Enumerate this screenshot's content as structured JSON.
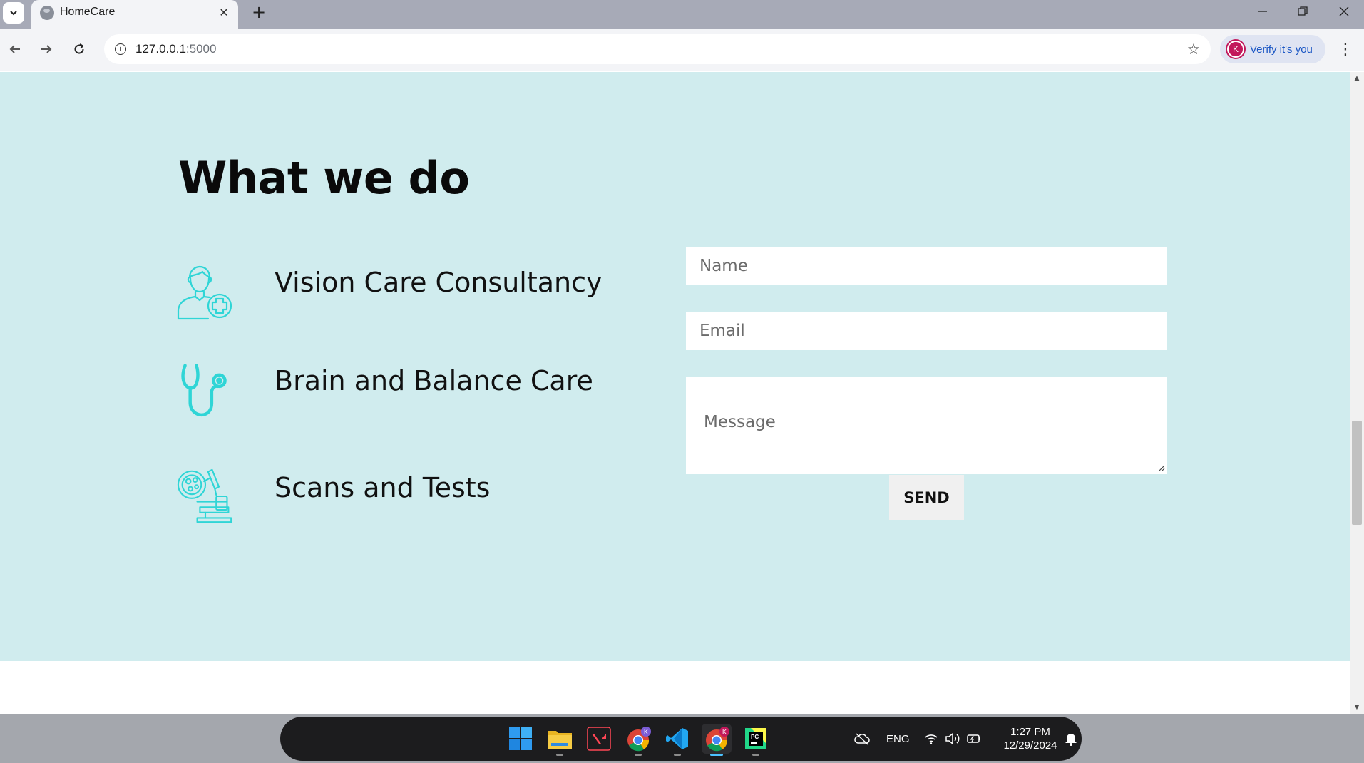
{
  "browser": {
    "tab_title": "HomeCare",
    "url_host": "127.0.0.1",
    "url_port": ":5000",
    "verify_label": "Verify it's you",
    "avatar_letter": "K"
  },
  "page": {
    "heading": "What we do",
    "services": [
      {
        "label": "Vision Care Consultancy",
        "icon": "doctor-plus-icon"
      },
      {
        "label": "Brain and Balance Care",
        "icon": "stethoscope-icon"
      },
      {
        "label": "Scans and Tests",
        "icon": "microscope-icon"
      }
    ],
    "form": {
      "name_placeholder": "Name",
      "email_placeholder": "Email",
      "message_placeholder": "Message",
      "send_label": "SEND"
    }
  },
  "taskbar": {
    "language": "ENG",
    "time": "1:27 PM",
    "date": "12/29/2024",
    "apps": [
      "start-icon",
      "file-explorer-icon",
      "valorant-icon",
      "chrome-icon",
      "vscode-icon",
      "chrome-active-icon",
      "pycharm-icon"
    ]
  },
  "colors": {
    "section_bg": "#d0ecee",
    "icon_accent": "#2fd5d6",
    "send_bg": "#f0f0f0"
  }
}
